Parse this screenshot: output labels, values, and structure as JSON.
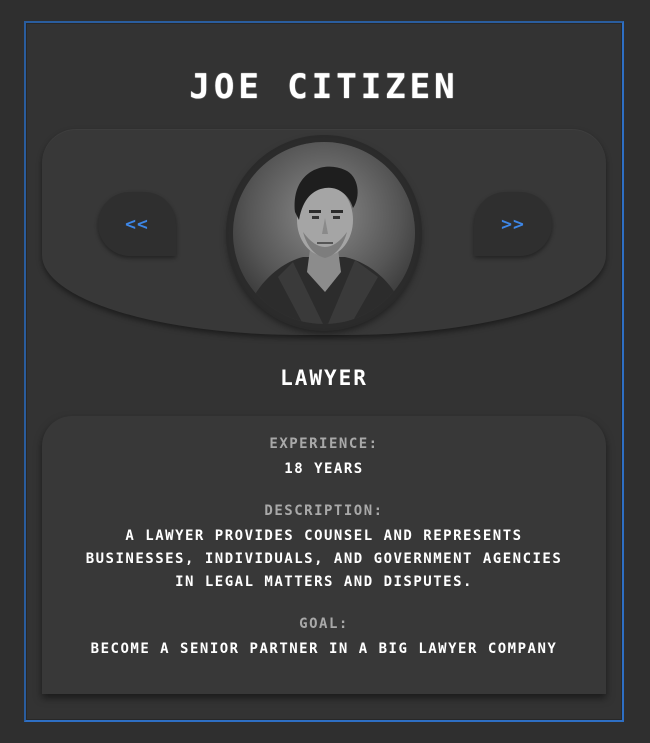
{
  "profile": {
    "name": "JOE CITIZEN",
    "role": "LAWYER",
    "prev_label": "<<",
    "next_label": ">>",
    "experience_label": "EXPERIENCE:",
    "experience_value": "18 YEARS",
    "description_label": "DESCRIPTION:",
    "description_value": "A LAWYER PROVIDES COUNSEL AND REPRESENTS BUSINESSES, INDIVIDUALS, AND GOVERNMENT AGENCIES IN LEGAL MATTERS AND DISPUTES.",
    "goal_label": "GOAL:",
    "goal_value": "BECOME A SENIOR PARTNER IN A BIG LAWYER COMPANY"
  },
  "colors": {
    "accent": "#3d86e6",
    "border": "#2e6fc4",
    "background": "#2f2f2f",
    "panel": "#383838"
  },
  "icons": {
    "prev": "double-chevron-left-icon",
    "next": "double-chevron-right-icon"
  }
}
